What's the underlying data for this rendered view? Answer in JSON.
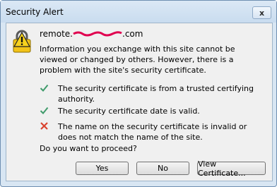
{
  "window": {
    "title": "Security Alert",
    "close_glyph": "x"
  },
  "alert": {
    "host_prefix": "remote.",
    "host_suffix": ".com",
    "info": "Information you exchange with this site cannot be viewed or changed by others. However, there is a problem with the site's security certificate.",
    "checks": [
      {
        "status": "ok",
        "icon": "check-icon",
        "text": "The security certificate is from a trusted certifying authority."
      },
      {
        "status": "ok",
        "icon": "check-icon",
        "text": "The security certificate date is valid."
      },
      {
        "status": "error",
        "icon": "x-icon",
        "text": "The name on the security certificate is invalid or does not match the name of the site."
      }
    ],
    "question": "Do you want to proceed?"
  },
  "buttons": {
    "yes": "Yes",
    "no": "No",
    "view": "View Certificate..."
  },
  "colors": {
    "check": "#3f9b6b",
    "error": "#d9432f",
    "redaction": "#e0004f"
  }
}
